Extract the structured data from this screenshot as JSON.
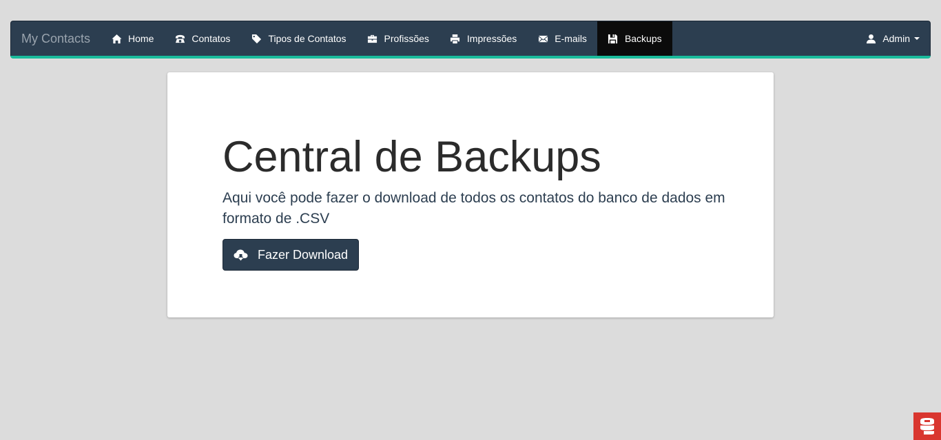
{
  "navbar": {
    "brand": "My Contacts",
    "items": [
      {
        "label": "Home",
        "icon": "home-icon"
      },
      {
        "label": "Contatos",
        "icon": "phone-icon"
      },
      {
        "label": "Tipos de Contatos",
        "icon": "tag-icon"
      },
      {
        "label": "Profissões",
        "icon": "briefcase-icon"
      },
      {
        "label": "Impressões",
        "icon": "print-icon"
      },
      {
        "label": "E-mails",
        "icon": "envelope-icon"
      },
      {
        "label": "Backups",
        "icon": "save-icon",
        "active": true
      }
    ],
    "user": {
      "label": "Admin",
      "icon": "user-icon"
    },
    "accent_color": "#1abc9c",
    "background_color": "#2c3e50"
  },
  "main": {
    "title": "Central de Backups",
    "description": "Aqui você pode fazer o download de todos os contatos do banco de dados em formato de .CSV",
    "download_button": {
      "label": "Fazer Download",
      "icon": "cloud-download-icon"
    }
  },
  "corner_widget": {
    "icon": "app-badge-icon",
    "color": "#d9362f"
  }
}
